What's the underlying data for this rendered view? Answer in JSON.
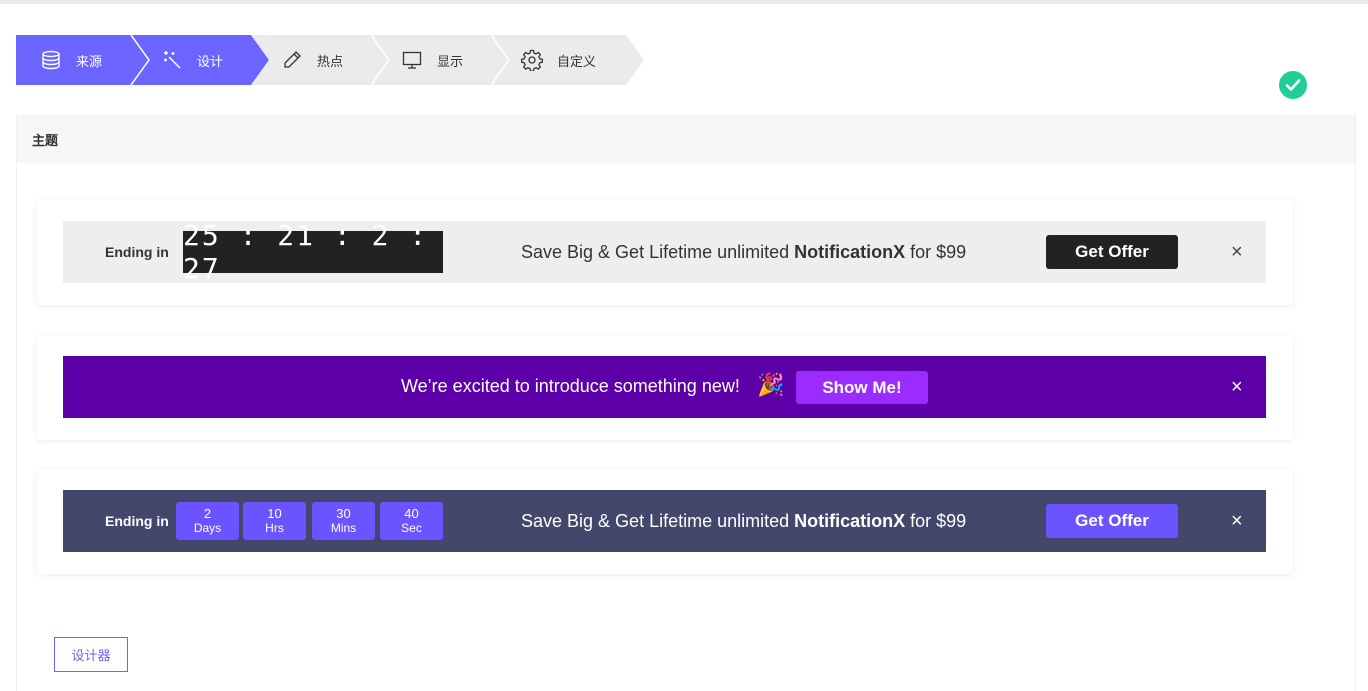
{
  "steps": [
    {
      "label": "来源",
      "icon": "database-icon"
    },
    {
      "label": "设计",
      "icon": "magic-wand-icon"
    },
    {
      "label": "热点",
      "icon": "pencil-icon"
    },
    {
      "label": "显示",
      "icon": "monitor-icon"
    },
    {
      "label": "自定义",
      "icon": "gear-icon"
    }
  ],
  "colors": {
    "accent": "#6b64ff",
    "step_inactive": "#ebebeb",
    "selected_check": "#1fcf97"
  },
  "section": {
    "title": "主题"
  },
  "themes": [
    {
      "selected": true,
      "ending_label": "Ending in",
      "clock": "25:21:2:27",
      "message_prefix": "Save Big & Get Lifetime unlimited ",
      "message_bold": "NotificationX",
      "message_suffix": " for $99",
      "button": "Get Offer",
      "close": "×"
    },
    {
      "selected": false,
      "message": "We’re excited to introduce something new!",
      "emoji": "🎉",
      "button": "Show Me!",
      "close": "×"
    },
    {
      "selected": false,
      "ending_label": "Ending in",
      "countdown": [
        {
          "value": "2",
          "unit": "Days"
        },
        {
          "value": "10",
          "unit": "Hrs"
        },
        {
          "value": "30",
          "unit": "Mins"
        },
        {
          "value": "40",
          "unit": "Sec"
        }
      ],
      "message_prefix": "Save Big & Get Lifetime unlimited ",
      "message_bold": "NotificationX",
      "message_suffix": " for $99",
      "button": "Get Offer",
      "close": "×"
    }
  ],
  "designer_button": "设计器"
}
